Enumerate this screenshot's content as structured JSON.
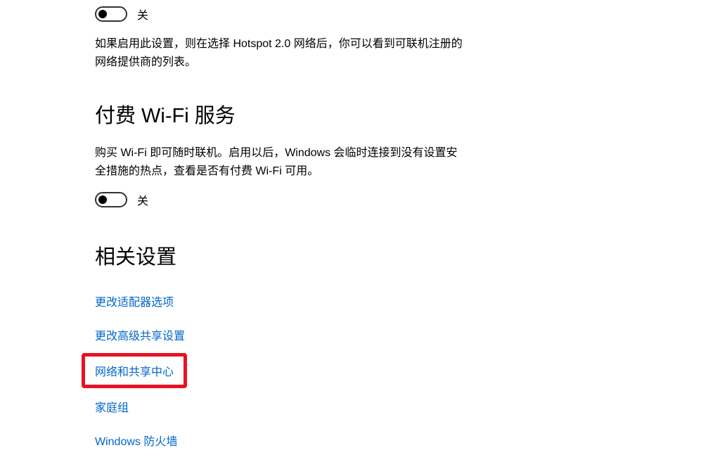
{
  "hotspot": {
    "toggle_label": "关",
    "description": "如果启用此设置，则在选择 Hotspot 2.0 网络后，你可以看到可联机注册的网络提供商的列表。"
  },
  "paid_wifi": {
    "heading": "付费 Wi-Fi 服务",
    "description": "购买 Wi-Fi 即可随时联机。启用以后，Windows 会临时连接到没有设置安全措施的热点，查看是否有付费 Wi-Fi 可用。",
    "toggle_label": "关"
  },
  "related": {
    "heading": "相关设置",
    "links": {
      "adapter_options": "更改适配器选项",
      "advanced_sharing": "更改高级共享设置",
      "network_sharing_center": "网络和共享中心",
      "homegroup": "家庭组",
      "windows_firewall": "Windows 防火墙"
    }
  }
}
